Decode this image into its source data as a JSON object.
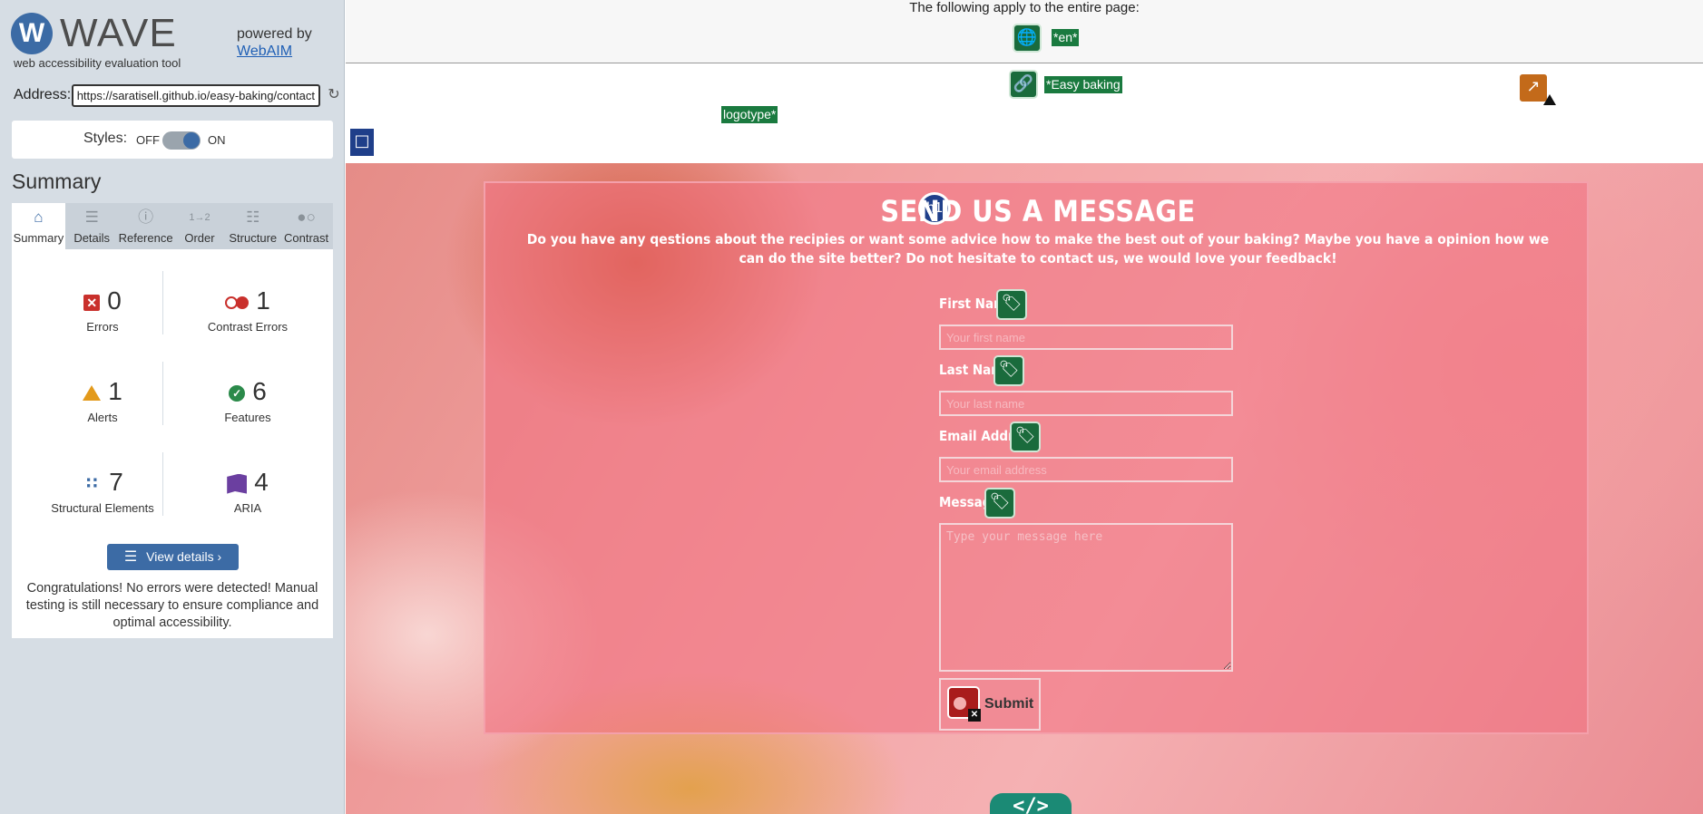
{
  "wave": {
    "logo_letter": "W",
    "logo_text": "WAVE",
    "subtitle": "web accessibility evaluation tool",
    "powered_by": "powered by",
    "webaim_link": "WebAIM",
    "address_label": "Address:",
    "address_value": "https://saratisell.github.io/easy-baking/contact",
    "styles_label": "Styles:",
    "styles_off": "OFF",
    "styles_on": "ON",
    "styles_enabled": true,
    "summary_heading": "Summary",
    "tabs": [
      {
        "label": "Summary",
        "icon": "home-icon",
        "active": true
      },
      {
        "label": "Details",
        "icon": "list-icon",
        "active": false
      },
      {
        "label": "Reference",
        "icon": "info-icon",
        "active": false
      },
      {
        "label": "Order",
        "icon": "order-icon",
        "active": false
      },
      {
        "label": "Structure",
        "icon": "structure-icon",
        "active": false
      },
      {
        "label": "Contrast",
        "icon": "contrast-icon",
        "active": false
      }
    ],
    "stats": {
      "errors": {
        "count": "0",
        "label": "Errors"
      },
      "contrast_errors": {
        "count": "1",
        "label": "Contrast Errors"
      },
      "alerts": {
        "count": "1",
        "label": "Alerts"
      },
      "features": {
        "count": "6",
        "label": "Features"
      },
      "structural": {
        "count": "7",
        "label": "Structural Elements"
      },
      "aria": {
        "count": "4",
        "label": "ARIA"
      }
    },
    "view_details": "View details ›",
    "congrats": "Congratulations! No errors were detected! Manual testing is still necessary to ensure compliance and optimal accessibility."
  },
  "page_notice": {
    "text": "The following apply to the entire page:",
    "lang_label": "*en*",
    "logo_label_1": "*Easy baking",
    "logo_label_2": "logotype*"
  },
  "form": {
    "h1_badge": "h1",
    "title": "SEND US A MESSAGE",
    "intro": "Do you have any qestions about the recipies or want some advice how to make the best out of your baking? Maybe you have a opinion how we can do the site better? Do not hesitate to contact us, we would love your feedback!",
    "first_name_label": "First Name",
    "first_name_placeholder": "Your first name",
    "last_name_label": "Last Name",
    "last_name_placeholder": "Your last name",
    "email_label": "Email Address",
    "email_placeholder": "Your email address",
    "message_label": "Message",
    "message_placeholder": "Type your message here",
    "submit_label": "Submit"
  },
  "code_badge": "</>",
  "colors": {
    "wave_blue": "#3c6ba5",
    "error_red": "#c9302c",
    "feature_green": "#1a6b3c",
    "form_overlay": "#f06e7d"
  }
}
